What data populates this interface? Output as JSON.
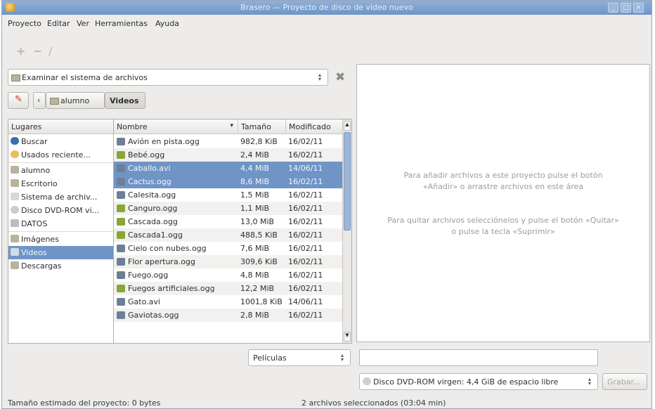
{
  "window": {
    "title": "Brasero — Proyecto de disco de vídeo nuevo",
    "accent": "#6f95c6"
  },
  "menu": [
    "Proyecto",
    "Editar",
    "Ver",
    "Herramientas",
    "Ayuda"
  ],
  "toolbar": {
    "add_icon": "plus-icon",
    "remove_icon": "minus-icon",
    "clear_icon": "broom-icon"
  },
  "browser": {
    "source_label": "Examinar el sistema de archivos",
    "close_icon": "close-icon",
    "breadcrumb": {
      "parent": "alumno",
      "current": "Videos"
    }
  },
  "places": {
    "header": "Lugares",
    "items": [
      {
        "label": "Buscar",
        "icon": "search-icon"
      },
      {
        "label": "Usados reciente...",
        "icon": "recent-icon"
      },
      {
        "label": "alumno",
        "icon": "home-folder-icon"
      },
      {
        "label": "Escritorio",
        "icon": "desktop-icon"
      },
      {
        "label": "Sistema de archiv...",
        "icon": "filesystem-icon"
      },
      {
        "label": "Disco DVD-ROM vi...",
        "icon": "dvd-icon"
      },
      {
        "label": "DATOS",
        "icon": "drive-icon"
      },
      {
        "label": "Imágenes",
        "icon": "folder-icon"
      },
      {
        "label": "Videos",
        "icon": "folder-icon",
        "selected": true
      },
      {
        "label": "Descargas",
        "icon": "folder-icon"
      }
    ]
  },
  "files": {
    "columns": {
      "name": "Nombre",
      "size": "Tamaño",
      "modified": "Modificado"
    },
    "rows": [
      {
        "name": "Avión en pista.ogg",
        "size": "982,8 KiB",
        "date": "16/02/11",
        "icon": "video-file-icon"
      },
      {
        "name": "Bebé.ogg",
        "size": "2,4 MiB",
        "date": "16/02/11",
        "icon": "film-file-icon"
      },
      {
        "name": "Caballo.avi",
        "size": "4,4 MiB",
        "date": "14/06/11",
        "icon": "video-file-icon",
        "selected": true
      },
      {
        "name": "Cactus.ogg",
        "size": "8,6 MiB",
        "date": "16/02/11",
        "icon": "video-file-icon",
        "selected": true
      },
      {
        "name": "Calesita.ogg",
        "size": "1,5 MiB",
        "date": "16/02/11",
        "icon": "video-file-icon"
      },
      {
        "name": "Canguro.ogg",
        "size": "1,1 MiB",
        "date": "16/02/11",
        "icon": "film-file-icon"
      },
      {
        "name": "Cascada.ogg",
        "size": "13,0 MiB",
        "date": "16/02/11",
        "icon": "film-file-icon"
      },
      {
        "name": "Cascada1.ogg",
        "size": "488,5 KiB",
        "date": "16/02/11",
        "icon": "film-file-icon"
      },
      {
        "name": "Cielo con nubes.ogg",
        "size": "7,6 MiB",
        "date": "16/02/11",
        "icon": "video-file-icon"
      },
      {
        "name": "Flor apertura.ogg",
        "size": "309,6 KiB",
        "date": "16/02/11",
        "icon": "video-file-icon"
      },
      {
        "name": "Fuego.ogg",
        "size": "4,8 MiB",
        "date": "16/02/11",
        "icon": "video-file-icon"
      },
      {
        "name": "Fuegos artificiales.ogg",
        "size": "12,2 MiB",
        "date": "16/02/11",
        "icon": "film-file-icon"
      },
      {
        "name": "Gato.avi",
        "size": "1001,8 KiB",
        "date": "14/06/11",
        "icon": "video-file-icon"
      },
      {
        "name": "Gaviotas.ogg",
        "size": "2,8 MiB",
        "date": "16/02/11",
        "icon": "video-file-icon"
      }
    ]
  },
  "filter": {
    "selected": "Películas"
  },
  "project": {
    "hint_add": [
      "Para añadir archivos a este proyecto pulse el botón",
      "«Añadir» o arrastre archivos en este área"
    ],
    "hint_remove": [
      "Para quitar archivos selecciónelos y pulse el botón «Quitar»",
      "o pulse la tecla «Suprimir»"
    ],
    "name_value": "",
    "disc_label": "Disco DVD-ROM virgen: 4,4 GiB de espacio libre",
    "burn_label": "Grabar..."
  },
  "status": {
    "estimate": "Tamaño estimado del proyecto: 0 bytes",
    "selection": "2 archivos seleccionados (03:04 min)"
  }
}
